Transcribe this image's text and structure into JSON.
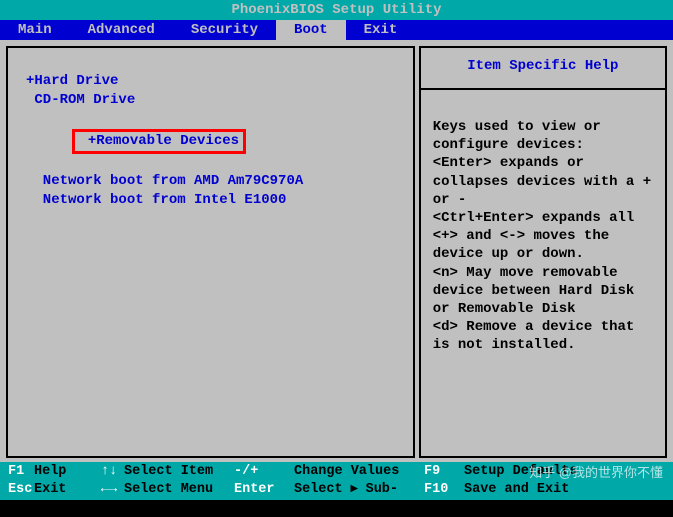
{
  "title": "PhoenixBIOS Setup Utility",
  "menu": {
    "items": [
      "Main",
      "Advanced",
      "Security",
      "Boot",
      "Exit"
    ],
    "active_index": 3
  },
  "boot": {
    "items": [
      "+Hard Drive",
      " CD-ROM Drive",
      " +Removable Devices",
      "  Network boot from AMD Am79C970A",
      "  Network boot from Intel E1000"
    ],
    "highlighted_index": 2
  },
  "help": {
    "title": "Item Specific Help",
    "body": "Keys used to view or configure devices:\n<Enter> expands or collapses devices with a + or -\n<Ctrl+Enter> expands all\n<+> and <-> moves the device up or down.\n<n> May move removable device between Hard Disk or Removable Disk\n<d> Remove a device that is not installed."
  },
  "footer": {
    "r1": {
      "k1": "F1",
      "l1": "Help",
      "a1": "↑↓",
      "l2": "Select Item",
      "a2": "-/+",
      "l3": "Change Values",
      "k2": "F9",
      "l4": "Setup Defaults"
    },
    "r2": {
      "k1": "Esc",
      "l1": "Exit",
      "a1": "←→",
      "l2": "Select Menu",
      "a2": "Enter",
      "l3": "Select ▸ Sub-Menu",
      "k2": "F10",
      "l4": "Save and Exit"
    }
  },
  "watermark": "知乎 @我的世界你不懂"
}
